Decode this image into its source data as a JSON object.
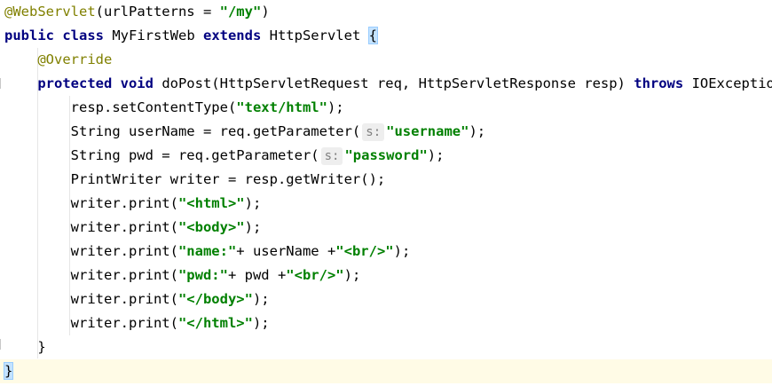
{
  "editor": {
    "lines": [
      {
        "segments": [
          {
            "t": "ann",
            "v": "@WebServlet"
          },
          {
            "t": "plain",
            "v": "(urlPatterns = "
          },
          {
            "t": "str",
            "v": "\"/my\""
          },
          {
            "t": "plain",
            "v": ")"
          }
        ]
      },
      {
        "segments": [
          {
            "t": "kw",
            "v": "public class "
          },
          {
            "t": "plain",
            "v": "MyFirstWeb "
          },
          {
            "t": "kw",
            "v": "extends "
          },
          {
            "t": "plain",
            "v": "HttpServlet "
          },
          {
            "t": "brace",
            "v": "{"
          }
        ]
      },
      {
        "segments": [
          {
            "t": "plain",
            "v": "    "
          },
          {
            "t": "ann",
            "v": "@Override"
          }
        ]
      },
      {
        "segments": [
          {
            "t": "plain",
            "v": "    "
          },
          {
            "t": "kw",
            "v": "protected void "
          },
          {
            "t": "plain",
            "v": "doPost(HttpServletRequest req, HttpServletResponse resp) "
          },
          {
            "t": "kw",
            "v": "throws "
          },
          {
            "t": "plain",
            "v": "IOException {"
          }
        ]
      },
      {
        "segments": [
          {
            "t": "plain",
            "v": "        resp.setContentType("
          },
          {
            "t": "str",
            "v": "\"text/html\""
          },
          {
            "t": "plain",
            "v": ");"
          }
        ]
      },
      {
        "segments": [
          {
            "t": "plain",
            "v": "        String userName = req.getParameter("
          },
          {
            "t": "hint",
            "v": "s:"
          },
          {
            "t": "str",
            "v": "\"username\""
          },
          {
            "t": "plain",
            "v": ");"
          }
        ]
      },
      {
        "segments": [
          {
            "t": "plain",
            "v": "        String pwd = req.getParameter("
          },
          {
            "t": "hint",
            "v": "s:"
          },
          {
            "t": "str",
            "v": "\"password\""
          },
          {
            "t": "plain",
            "v": ");"
          }
        ]
      },
      {
        "segments": [
          {
            "t": "plain",
            "v": "        PrintWriter writer = resp.getWriter();"
          }
        ]
      },
      {
        "segments": [
          {
            "t": "plain",
            "v": "        writer.print("
          },
          {
            "t": "str",
            "v": "\"<html>\""
          },
          {
            "t": "plain",
            "v": ");"
          }
        ]
      },
      {
        "segments": [
          {
            "t": "plain",
            "v": "        writer.print("
          },
          {
            "t": "str",
            "v": "\"<body>\""
          },
          {
            "t": "plain",
            "v": ");"
          }
        ]
      },
      {
        "segments": [
          {
            "t": "plain",
            "v": "        writer.print("
          },
          {
            "t": "str",
            "v": "\"name:\""
          },
          {
            "t": "plain",
            "v": "+ userName +"
          },
          {
            "t": "str",
            "v": "\"<br/>\""
          },
          {
            "t": "plain",
            "v": ");"
          }
        ]
      },
      {
        "segments": [
          {
            "t": "plain",
            "v": "        writer.print("
          },
          {
            "t": "str",
            "v": "\"pwd:\""
          },
          {
            "t": "plain",
            "v": "+ pwd +"
          },
          {
            "t": "str",
            "v": "\"<br/>\""
          },
          {
            "t": "plain",
            "v": ");"
          }
        ]
      },
      {
        "segments": [
          {
            "t": "plain",
            "v": "        writer.print("
          },
          {
            "t": "str",
            "v": "\"</body>\""
          },
          {
            "t": "plain",
            "v": ");"
          }
        ]
      },
      {
        "segments": [
          {
            "t": "plain",
            "v": "        writer.print("
          },
          {
            "t": "str",
            "v": "\"</html>\""
          },
          {
            "t": "plain",
            "v": ");"
          }
        ]
      },
      {
        "segments": [
          {
            "t": "plain",
            "v": "    }"
          }
        ]
      },
      {
        "segments": [
          {
            "t": "brace",
            "v": "}"
          }
        ]
      }
    ],
    "current_line": 15
  }
}
